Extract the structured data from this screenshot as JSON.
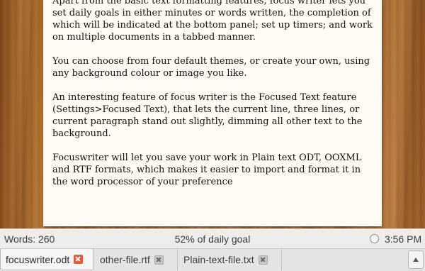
{
  "document": {
    "paragraphs": [
      "Apart from the basic text formatting features, focus writer lets you set daily goals in either minutes or words written, the completion of which will be indicated at the bottom panel; set up timers; and work on multiple documents in a tabbed manner.",
      "You can choose from four default themes, or create your own, using any background colour or image you like.",
      "An interesting feature of focus writer is the Focused Text feature (Settings>Focused Text), that lets the current line, three lines, or current paragraph stand out slightly, dimming all other text to the background.",
      "Focuswriter will let you save your work in Plain text ODT, OOXML and RTF formats, which makes it easier to import and format it in the word processor of your preference"
    ]
  },
  "status_bar": {
    "word_count": "Words: 260",
    "daily_goal": "52% of daily goal",
    "timer_icon": "timer-icon",
    "clock": "3:56 PM"
  },
  "tabs": [
    {
      "label": "focuswriter.odt",
      "active": true
    },
    {
      "label": "other-file.rtf",
      "active": false
    },
    {
      "label": "Plain-text-file.txt",
      "active": false
    }
  ],
  "colors": {
    "wood_background": "#9c5d25",
    "page_background": "#fdfbf3",
    "active_tab_close": "#e25c3a"
  }
}
